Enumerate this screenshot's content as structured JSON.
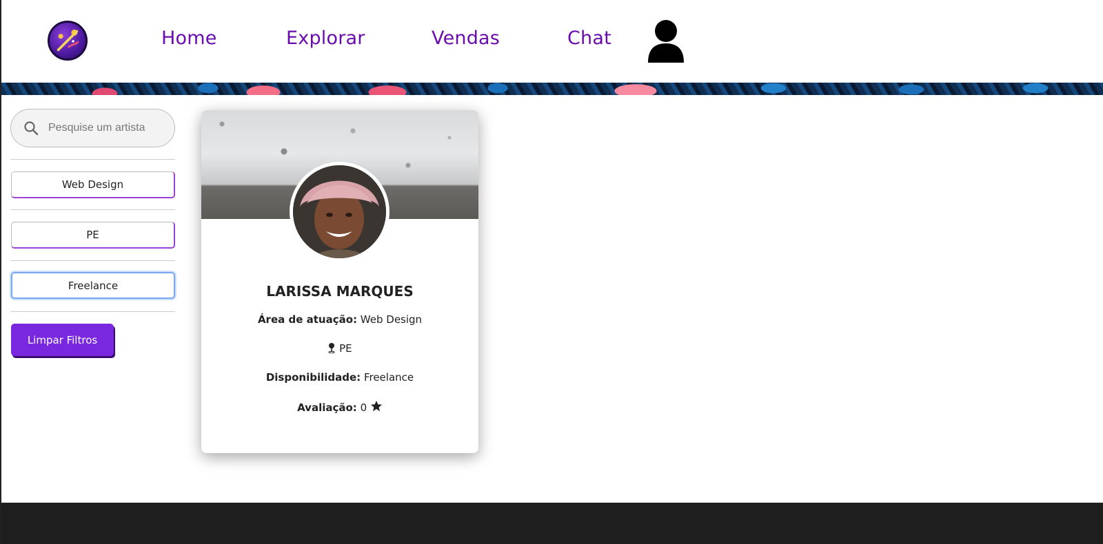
{
  "nav": {
    "home": "Home",
    "explorar": "Explorar",
    "vendas": "Vendas",
    "chat": "Chat"
  },
  "sidebar": {
    "search_placeholder": "Pesquise um artista",
    "filters": [
      "Web Design",
      "PE",
      "Freelance"
    ],
    "clear_label": "Limpar Filtros"
  },
  "card": {
    "name": "LARISSA MARQUES",
    "area_label": "Área de atuação:",
    "area_value": "Web Design",
    "location": "PE",
    "availability_label": "Disponibilidade:",
    "availability_value": "Freelance",
    "rating_label": "Avaliação:",
    "rating_value": "0"
  },
  "colors": {
    "accent": "#6a0dad",
    "button": "#7a28e0",
    "footer": "#1e1e1e"
  }
}
